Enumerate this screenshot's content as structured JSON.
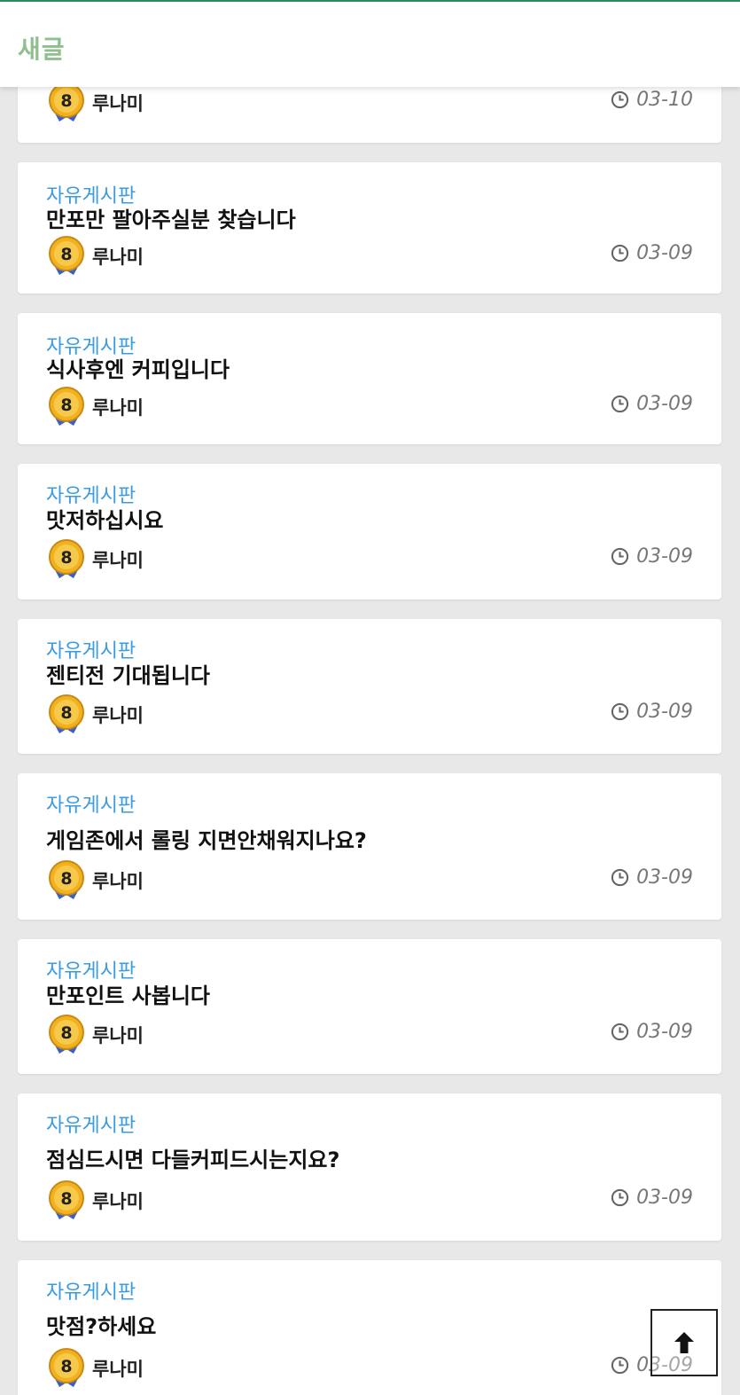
{
  "header": {
    "title": "새글"
  },
  "posts": [
    {
      "category": "",
      "title": "",
      "author": "루나미",
      "date": "03-10"
    },
    {
      "category": "자유게시판",
      "title": "만포만 팔아주실분 찾습니다",
      "author": "루나미",
      "date": "03-09"
    },
    {
      "category": "자유게시판",
      "title": "식사후엔 커피입니다",
      "author": "루나미",
      "date": "03-09"
    },
    {
      "category": "자유게시판",
      "title": "맛저하십시요",
      "author": "루나미",
      "date": "03-09"
    },
    {
      "category": "자유게시판",
      "title": "젠티전 기대됩니다",
      "author": "루나미",
      "date": "03-09"
    },
    {
      "category": "자유게시판",
      "title": "게임존에서 롤링 지면안채워지나요?",
      "author": "루나미",
      "date": "03-09"
    },
    {
      "category": "자유게시판",
      "title": "만포인트 사봅니다",
      "author": "루나미",
      "date": "03-09"
    },
    {
      "category": "자유게시판",
      "title": "점심드시면 다들커피드시는지요?",
      "author": "루나미",
      "date": "03-09"
    },
    {
      "category": "자유게시판",
      "title": "맛점?하세요",
      "author": "루나미",
      "date": "03-09"
    }
  ],
  "badge": {
    "level": "8",
    "colors": {
      "gold": "#f2b11e",
      "ribbon": "#3b5fc9"
    }
  },
  "icons": {
    "date": "clock-icon",
    "scroll_top": "arrow-up-icon"
  }
}
